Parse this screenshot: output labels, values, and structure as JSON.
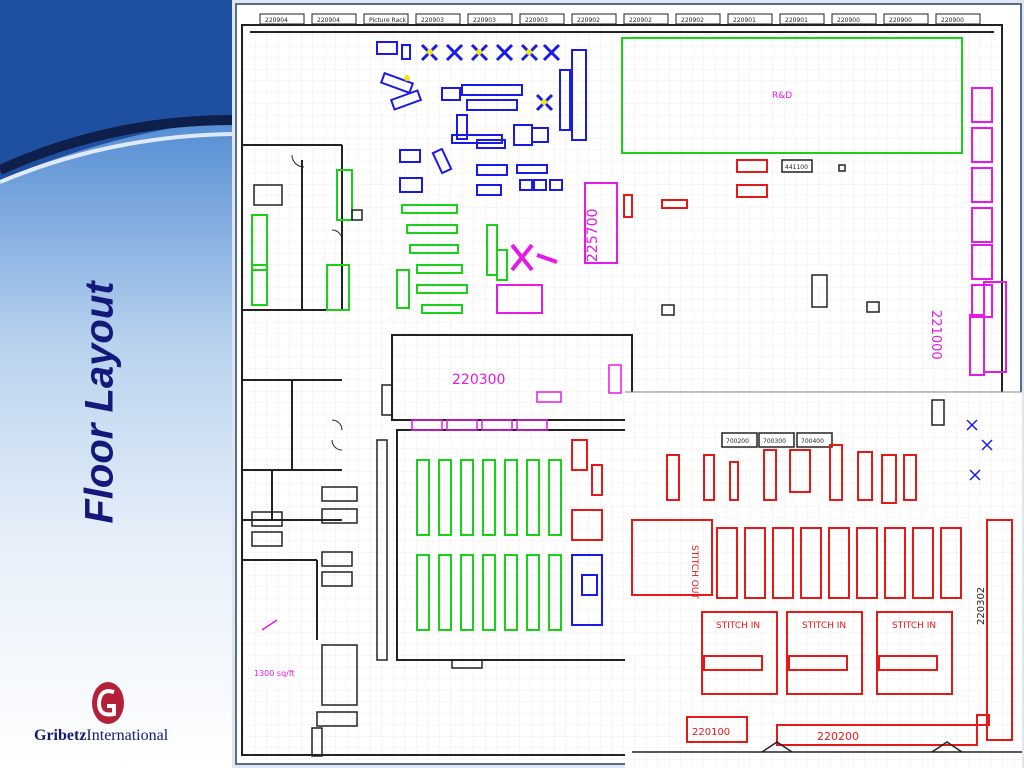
{
  "slide": {
    "title": "Floor Layout",
    "logo": {
      "name_bold": "Gribetz",
      "name_regular": "International"
    }
  },
  "colors": {
    "title": "#14187a",
    "blue": "#1a1ae6",
    "green": "#19d119",
    "magenta": "#e619e6",
    "red": "#e61919",
    "black": "#222222",
    "grid": "#c8c8c8",
    "logo_red": "#b3203a"
  },
  "floorplan": {
    "header_labels": [
      "220904",
      "220904",
      "Picture Rack",
      "220903",
      "220903",
      "220903",
      "220902",
      "220902",
      "220902",
      "220901",
      "220901",
      "220900",
      "220900",
      "220900"
    ],
    "areas": {
      "rd": "R&D",
      "a225700": "225700",
      "a220300": "220300",
      "a221000": "221000",
      "a220100": "220100",
      "a220200": "220200",
      "a220302": "220302",
      "a700400": "700400",
      "a700300": "700300",
      "a700200": "700200",
      "stitch_out": "STITCH OUT",
      "stitch_in_1": "STITCH IN",
      "stitch_in_2": "STITCH IN",
      "stitch_in_3": "STITCH IN",
      "sqft": "1300 sq/ft",
      "a441100": "441100"
    }
  }
}
